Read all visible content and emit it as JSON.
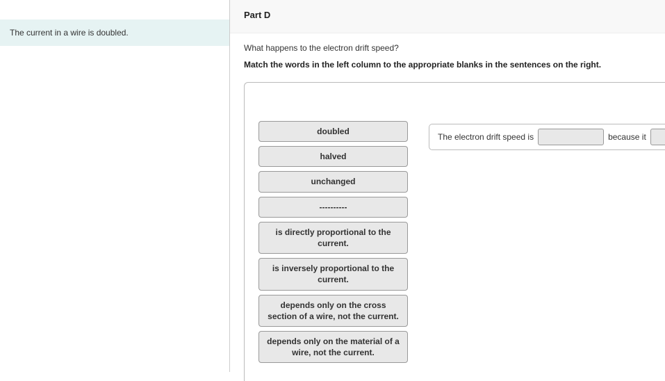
{
  "left_panel": {
    "prompt": "The current in a wire is doubled."
  },
  "right_panel": {
    "part_label": "Part D",
    "question": "What happens to the electron drift speed?",
    "instruction": "Match the words in the left column to the appropriate blanks in the sentences on the right.",
    "tiles": [
      "doubled",
      "halved",
      "unchanged",
      "----------",
      "is directly proportional to the current.",
      "is inversely proportional to the current.",
      "depends only on the cross section of a wire, not the current.",
      "depends only on the material of a wire, not the current."
    ],
    "sentence": {
      "seg1": "The electron drift speed is",
      "seg2": "because it"
    }
  }
}
